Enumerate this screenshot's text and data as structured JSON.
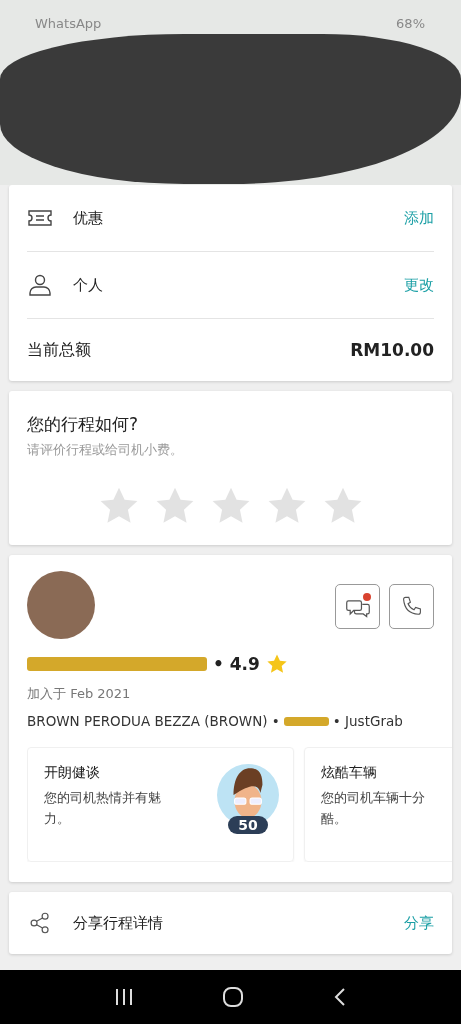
{
  "status_bar": {
    "notification": "WhatsApp",
    "battery": "68%"
  },
  "payment_card": {
    "rows": [
      {
        "kind": "coupon",
        "label": "优惠",
        "action": "添加"
      },
      {
        "kind": "profile",
        "label": "个人",
        "action": "更改"
      }
    ],
    "total": {
      "label": "当前总额",
      "amount": "RM10.00"
    }
  },
  "rating_card": {
    "title": "您的行程如何?",
    "subtitle": "请评价行程或给司机小费。",
    "stars": 0
  },
  "driver_card": {
    "rating": "• 4.9",
    "joined": "加入于 Feb 2021",
    "vehicle_before": "BROWN PERODUA BEZZA (BROWN) •",
    "vehicle_after": "• JustGrab",
    "chat_unread": true,
    "compliments": [
      {
        "title": "开朗健谈",
        "description": "您的司机热情并有魅力。",
        "count": "50"
      },
      {
        "title": "炫酷车辆",
        "description": "您的司机车辆十分酷。"
      }
    ]
  },
  "share_card": {
    "label": "分享行程详情",
    "action": "分享"
  }
}
